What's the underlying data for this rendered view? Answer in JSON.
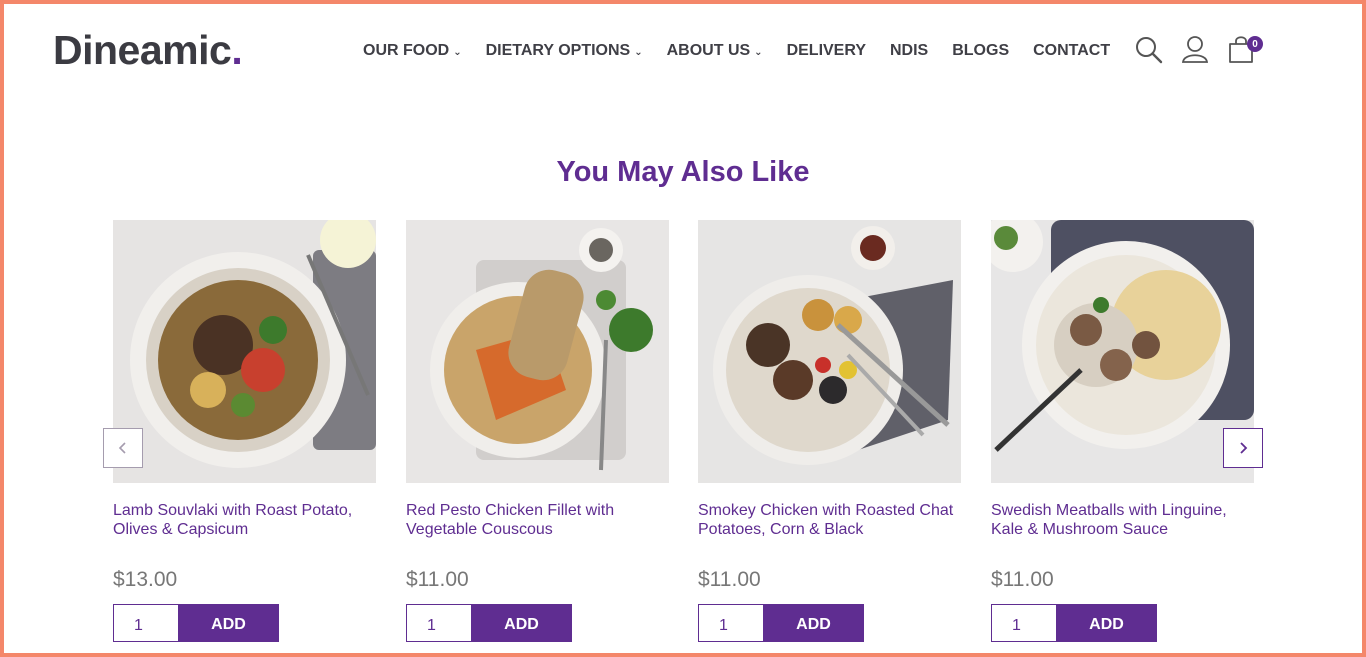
{
  "brand": {
    "name": "Dineamic",
    "dot": ".",
    "accent_color": "#5f2d91"
  },
  "nav": [
    {
      "label": "OUR FOOD",
      "dropdown": true
    },
    {
      "label": "DIETARY OPTIONS",
      "dropdown": true
    },
    {
      "label": "ABOUT US",
      "dropdown": true
    },
    {
      "label": "DELIVERY",
      "dropdown": false
    },
    {
      "label": "NDIS",
      "dropdown": false
    },
    {
      "label": "BLOGS",
      "dropdown": false
    },
    {
      "label": "CONTACT",
      "dropdown": false
    }
  ],
  "header_icons": {
    "search": "search-icon",
    "account": "user-icon",
    "cart": "shopping-bag-icon",
    "cart_count": "0"
  },
  "section": {
    "title": "You May Also Like"
  },
  "carousel": {
    "prev_icon": "chevron-left-icon",
    "next_icon": "chevron-right-icon"
  },
  "products": [
    {
      "name": "Lamb Souvlaki with Roast Potato, Olives & Capsicum",
      "price": "$13.00",
      "qty": "1",
      "add_label": "ADD"
    },
    {
      "name": "Red Pesto Chicken Fillet with Vegetable Couscous",
      "price": "$11.00",
      "qty": "1",
      "add_label": "ADD"
    },
    {
      "name": "Smokey Chicken with Roasted Chat Potatoes, Corn & Black",
      "price": "$11.00",
      "qty": "1",
      "add_label": "ADD"
    },
    {
      "name": "Swedish Meatballs with Linguine, Kale & Mushroom Sauce",
      "price": "$11.00",
      "qty": "1",
      "add_label": "ADD"
    }
  ]
}
